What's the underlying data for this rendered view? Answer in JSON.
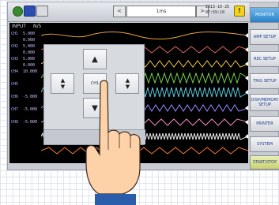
{
  "topbar": {
    "time_value": "1ms",
    "left_arrow": "<",
    "right_arrow": ">",
    "date_line1": "2013-10-25",
    "date_line2": "07:59:10",
    "warn_symbol": "!"
  },
  "screen": {
    "label": "INPUT",
    "scale": "N/5",
    "channels": [
      {
        "name": "CH1",
        "v1": "5.000",
        "v2": "0.000"
      },
      {
        "name": "CH2",
        "v1": "5.000",
        "v2": "0.000"
      },
      {
        "name": "CH3",
        "v1": "5.000",
        "v2": "0.000"
      },
      {
        "name": "CH4",
        "v1": "10.000",
        "v2": ""
      },
      {
        "name": "CH5",
        "v1": "",
        "v2": ""
      },
      {
        "name": "CH6",
        "v1": "-5.000",
        "v2": ""
      },
      {
        "name": "CH7",
        "v1": "-5.000",
        "v2": ""
      },
      {
        "name": "CH8",
        "v1": "-5.000",
        "v2": ""
      }
    ]
  },
  "dialog": {
    "up": "▲",
    "down": "▼",
    "left": "▲▼",
    "right": "▲▼",
    "center": "CH1"
  },
  "side_menu": [
    {
      "label": "MONITOR",
      "active": true
    },
    {
      "label": "AMP SETUP"
    },
    {
      "label": "REC SETUP"
    },
    {
      "label": "TRIG SETUP"
    },
    {
      "label": "DISP/MEMORY SETUP"
    },
    {
      "label": "PRINTER"
    },
    {
      "label": "SYSTEM"
    },
    {
      "label": "START/STOP",
      "last": true
    }
  ],
  "colors": {
    "screen_bg": "#000000",
    "active_button": "#2b82c9",
    "skin": "#fdd2a8"
  }
}
